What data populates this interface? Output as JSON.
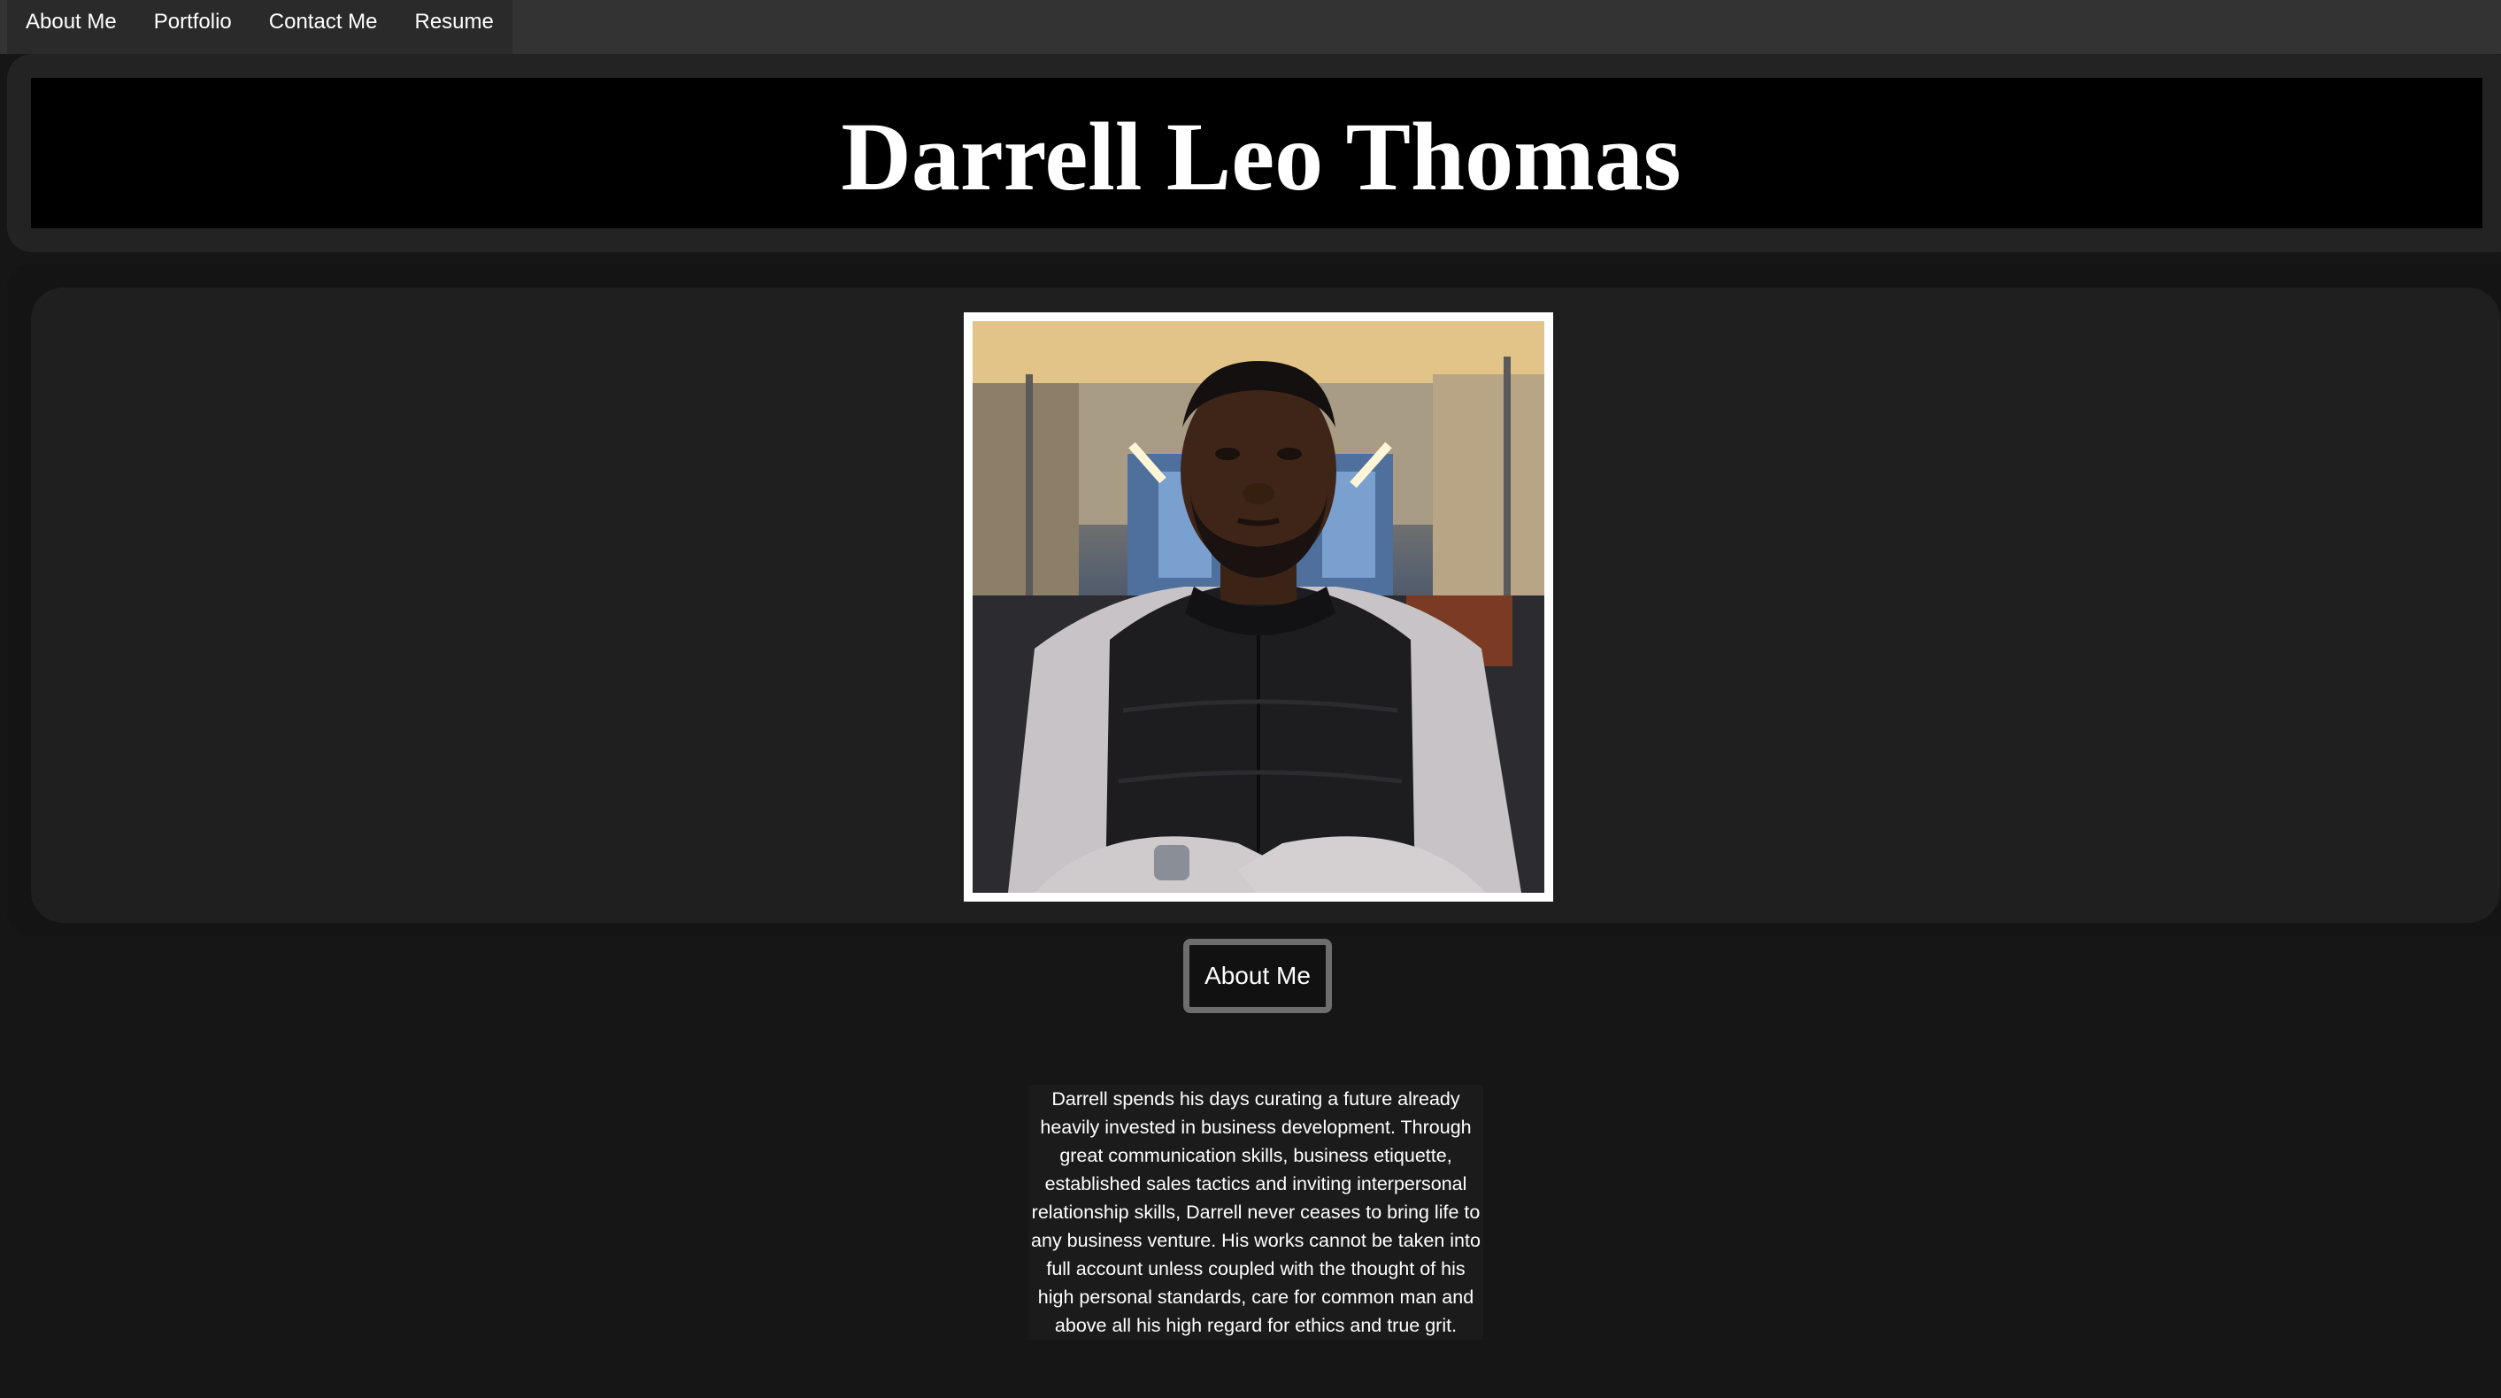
{
  "nav": {
    "items": [
      {
        "label": "About Me"
      },
      {
        "label": "Portfolio"
      },
      {
        "label": "Contact Me"
      },
      {
        "label": "Resume"
      }
    ]
  },
  "header": {
    "title": "Darrell Leo Thomas"
  },
  "profile": {
    "photo_icon": "portrait-photo"
  },
  "about": {
    "button_label": "About Me",
    "bio": "Darrell spends his days curating a future already heavily invested in business development. Through great communication skills, business etiquette, established sales tactics and inviting interpersonal relationship skills, Darrell never ceases to bring life to any business venture. His works cannot be taken into full account unless coupled with the thought of his high personal standards, care for common man and above all his high regard for ethics and true grit."
  },
  "colors": {
    "page_bg": "#161616",
    "nav_bg": "#333333",
    "header_bg": "#000000",
    "panel_bg": "#1f1f1f",
    "text": "#ffffff",
    "button_border": "#6d6d6d"
  }
}
